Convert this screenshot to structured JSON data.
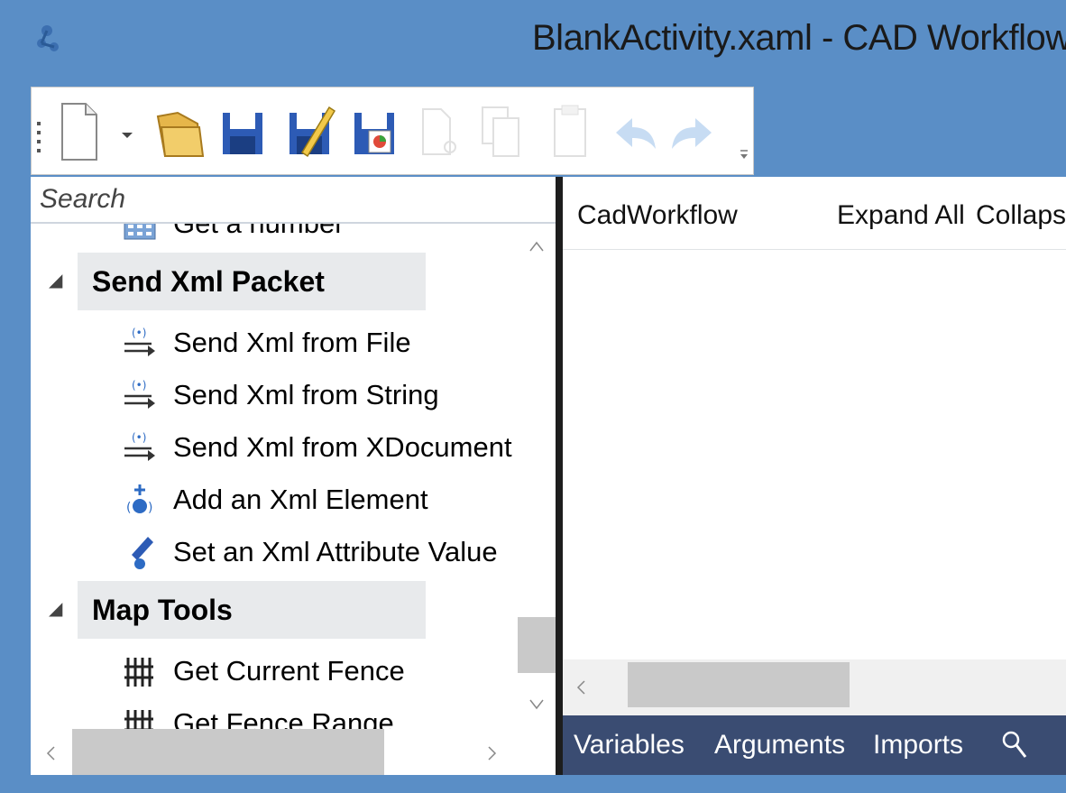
{
  "window": {
    "title": "BlankActivity.xaml - CAD Workflow"
  },
  "toolbar": {
    "buttons": [
      "new-document-icon",
      "dropdown-arrow-icon",
      "open-folder-icon",
      "save-icon",
      "save-as-icon",
      "save-all-icon",
      "cut-icon",
      "copy-icon",
      "paste-icon",
      "undo-icon",
      "redo-icon"
    ]
  },
  "toolbox": {
    "search_placeholder": "Search",
    "partial_item": "Get a number",
    "categories": [
      {
        "label": "Send Xml Packet",
        "items": [
          {
            "label": "Send Xml from File",
            "icon": "xml-send-icon"
          },
          {
            "label": "Send Xml from String",
            "icon": "xml-send-icon"
          },
          {
            "label": "Send Xml from XDocument",
            "icon": "xml-send-icon"
          },
          {
            "label": "Add an Xml Element",
            "icon": "xml-add-icon"
          },
          {
            "label": "Set an Xml Attribute Value",
            "icon": "xml-edit-icon"
          }
        ]
      },
      {
        "label": "Map Tools",
        "items": [
          {
            "label": "Get Current Fence",
            "icon": "fence-icon"
          },
          {
            "label": "Get Fence Range",
            "icon": "fence-icon"
          }
        ]
      }
    ]
  },
  "designer": {
    "breadcrumb": "CadWorkflow",
    "expand_all": "Expand All",
    "collapse_all": "Collapse All",
    "tabs": [
      "Variables",
      "Arguments",
      "Imports"
    ],
    "search_icon": "magnifier-icon"
  },
  "colors": {
    "title_bar": "#5a8ec6",
    "bottom_tabs": "#3a4c72",
    "category_bg": "#e8eaec",
    "scroll_thumb": "#c9c9c9"
  }
}
